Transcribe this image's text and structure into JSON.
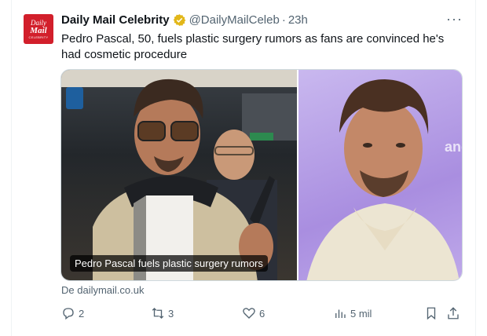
{
  "tweet": {
    "avatar": {
      "line1": "Daily",
      "line2": "Mail",
      "line3": "CELEBRITY"
    },
    "author_name": "Daily Mail Celebrity",
    "handle": "@DailyMailCeleb",
    "separator": "·",
    "time": "23h",
    "more": "···",
    "text": "Pedro Pascal, 50, fuels plastic surgery rumors as fans are convinced he's had cosmetic procedure",
    "card": {
      "caption": "Pedro Pascal fuels plastic surgery rumors",
      "background_text": "and"
    },
    "source": "De dailymail.co.uk",
    "actions": {
      "replies": "2",
      "retweets": "3",
      "likes": "6",
      "views": "5 mil"
    }
  },
  "colors": {
    "brand_red": "#d21f2b",
    "verified_gold": "#e2b719",
    "secondary_text": "#536471"
  }
}
